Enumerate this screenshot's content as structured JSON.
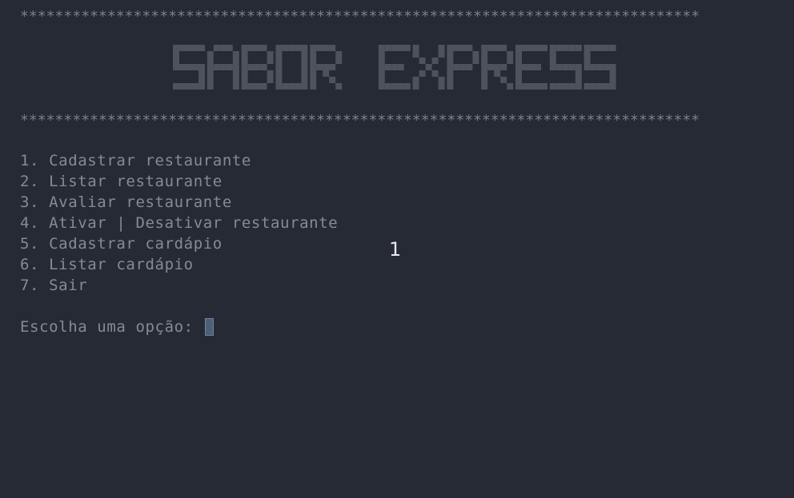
{
  "app": {
    "stars_line": "******************************************************************************",
    "banner_text": "SABOR EXPRESS",
    "menu": [
      {
        "label": "1. Cadastrar restaurante"
      },
      {
        "label": "2. Listar restaurante"
      },
      {
        "label": "3. Avaliar restaurante"
      },
      {
        "label": "4. Ativar | Desativar restaurante"
      },
      {
        "label": "5. Cadastrar cardápio"
      },
      {
        "label": "6. Listar cardápio"
      },
      {
        "label": "7. Sair"
      }
    ],
    "prompt": "Escolha uma opção: ",
    "overlay_number": "1"
  },
  "colors": {
    "background": "#252a34",
    "text": "#868b93",
    "banner": "#4d535c",
    "overlay": "#e6e8ec",
    "cursor": "#5b6f88"
  }
}
